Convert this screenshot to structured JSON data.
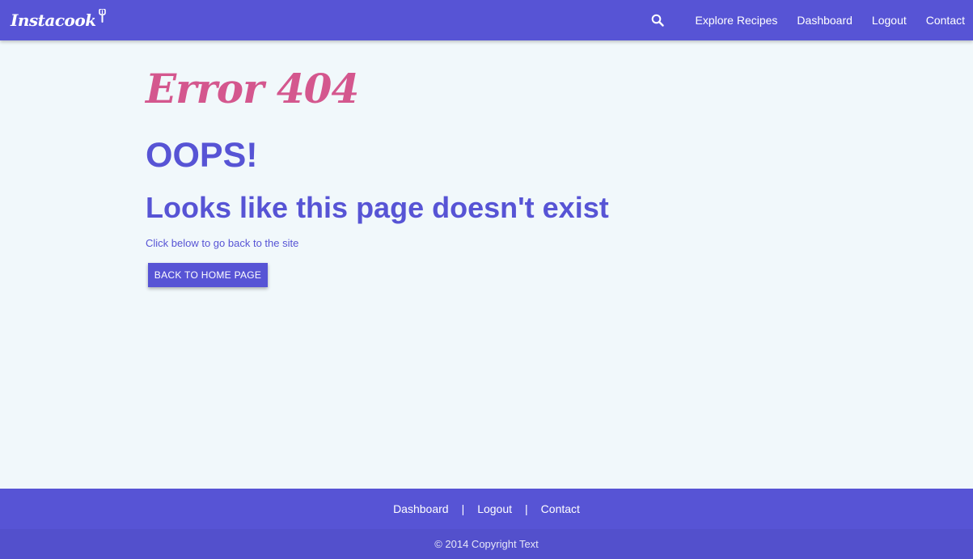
{
  "navbar": {
    "brand": "Instacook",
    "brand_icon": "whisk-icon",
    "search_icon": "search-icon",
    "links": [
      {
        "label": "Explore Recipes"
      },
      {
        "label": "Dashboard"
      },
      {
        "label": "Logout"
      },
      {
        "label": "Contact"
      }
    ]
  },
  "main": {
    "error_title": "Error 404",
    "oops": "OOPS!",
    "headline": "Looks like this page doesn't exist",
    "subtext": "Click below to go back to the site",
    "button_label": "BACK TO HOME PAGE"
  },
  "footer": {
    "links": [
      {
        "label": "Dashboard"
      },
      {
        "label": "Logout"
      },
      {
        "label": "Contact"
      }
    ],
    "separator": "|",
    "copyright": "© 2014 Copyright Text"
  },
  "colors": {
    "primary": "#5754d5",
    "accent": "#d4578e",
    "background": "#f1f8fb",
    "footer_bottom": "#5350cc"
  }
}
